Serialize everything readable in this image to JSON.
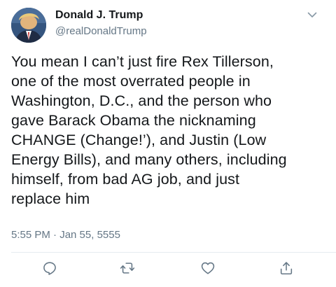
{
  "tweet": {
    "author": {
      "display_name": "Donald J. Trump",
      "handle": "@realDonaldTrump"
    },
    "text_lines": [
      "You mean I can’t just fire Rex Tillerson,",
      "one of the most overrated people in",
      "Washington, D.C., and the person who",
      "gave Barack Obama the nicknaming",
      "CHANGE (Change!’), and Justin (Low",
      "Energy Bills), and many others, including",
      "himself, from bad AG job, and just",
      "replace him"
    ],
    "timestamp": "5:55 PM · Jan 55, 5555"
  },
  "icons": {
    "menu": "chevron-down-icon",
    "reply": "reply-icon",
    "retweet": "retweet-icon",
    "like": "heart-icon",
    "share": "share-icon"
  },
  "colors": {
    "text": "#14171a",
    "secondary": "#657786",
    "divider": "#e6ecf0"
  }
}
